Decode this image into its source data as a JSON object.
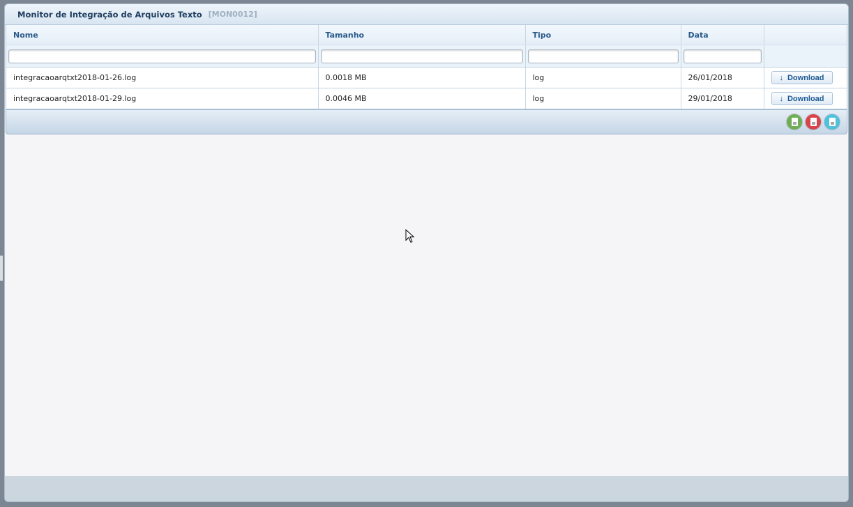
{
  "window": {
    "title": "Monitor de Integração de Arquivos Texto",
    "code": "[MON0012]"
  },
  "grid": {
    "columns": [
      "Nome",
      "Tamanho",
      "Tipo",
      "Data",
      ""
    ],
    "rows": [
      {
        "nome": "integracaoarqtxt2018-01-26.log",
        "tamanho": "0.0018 MB",
        "tipo": "log",
        "data": "26/01/2018",
        "action": "Download"
      },
      {
        "nome": "integracaoarqtxt2018-01-29.log",
        "tamanho": "0.0046 MB",
        "tipo": "log",
        "data": "29/01/2018",
        "action": "Download"
      }
    ],
    "filters": {
      "nome": "",
      "tamanho": "",
      "tipo": "",
      "data": ""
    }
  },
  "icons": {
    "download": "download-arrow-icon",
    "export_excel": "export-excel-icon",
    "export_pdf": "export-pdf-icon",
    "export_csv": "export-csv-icon"
  },
  "colors": {
    "header_text": "#2a5a8a",
    "title_text": "#1d3d5e",
    "code_text": "#9fb0c1",
    "excel": "#6fae55",
    "pdf": "#d9434b",
    "csv": "#4ec2dc"
  }
}
